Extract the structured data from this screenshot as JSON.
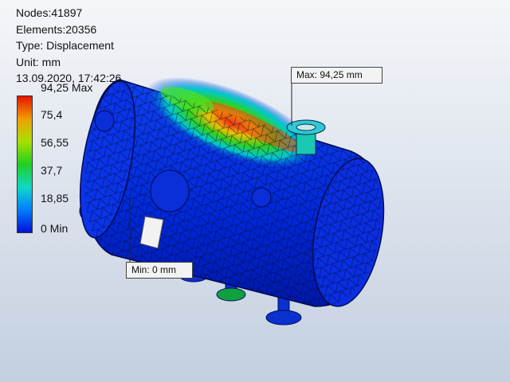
{
  "info": {
    "nodes": "Nodes:41897",
    "elements": "Elements:20356",
    "type": "Type: Displacement",
    "unit": "Unit: mm",
    "timestamp": "13.09.2020, 17:42:26"
  },
  "legend": {
    "max_label": "94,25 Max",
    "ticks": [
      "75,4",
      "56,55",
      "37,7",
      "18,85",
      "0 Min"
    ],
    "colors": [
      "#e81400",
      "#f0a000",
      "#a8e000",
      "#20d020",
      "#10d8c8",
      "#0080ff",
      "#0010d8"
    ]
  },
  "callouts": {
    "max": "Max: 94,25 mm",
    "min": "Min: 0 mm"
  }
}
